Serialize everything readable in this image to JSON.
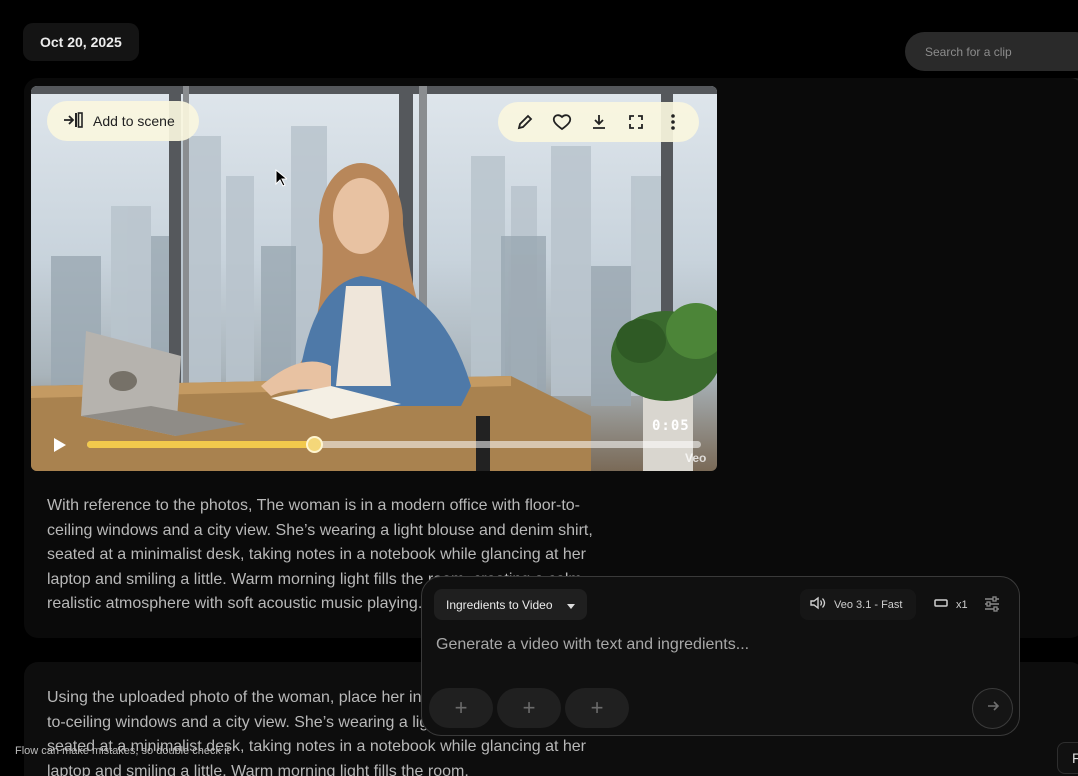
{
  "header": {
    "date": "Oct 20, 2025",
    "search_placeholder": "Search for a clip"
  },
  "clip": {
    "add_to_scene_label": "Add to scene",
    "toolbar_icons": [
      "edit-icon",
      "heart-icon",
      "download-icon",
      "fullscreen-icon",
      "more-vert-icon"
    ],
    "time": "0:05",
    "progress": 0.37,
    "watermark": "Veo",
    "description": "With reference to the photos, The woman is in a modern office with floor-to-ceiling windows and a city view. She’s wearing a light blouse and denim shirt, seated at a minimalist desk, taking notes in a notebook while glancing at her laptop and smiling a little. Warm morning light fills the room, creating a calm, realistic atmosphere with soft acoustic music playing."
  },
  "clip2": {
    "description": "Using the uploaded photo of the woman, place her in a modern office with floor-to-ceiling windows and a city view. She’s wearing a light blouse and denim shirt, seated at a minimalist desk, taking notes in a notebook while glancing at her laptop and smiling a little. Warm morning light fills the room,"
  },
  "composer": {
    "mode_label": "Ingredients to Video",
    "model_label": "Veo 3.1 - Fast",
    "count_label": "x1",
    "prompt_placeholder": "Generate a video with text and ingredients...",
    "add_slots": 3
  },
  "footer": {
    "note": "Flow can make mistakes, so double check it",
    "corner_label": "F"
  },
  "colors": {
    "accent": "#f2c94c",
    "pill_bg": "#faf6de",
    "background": "#000000"
  }
}
